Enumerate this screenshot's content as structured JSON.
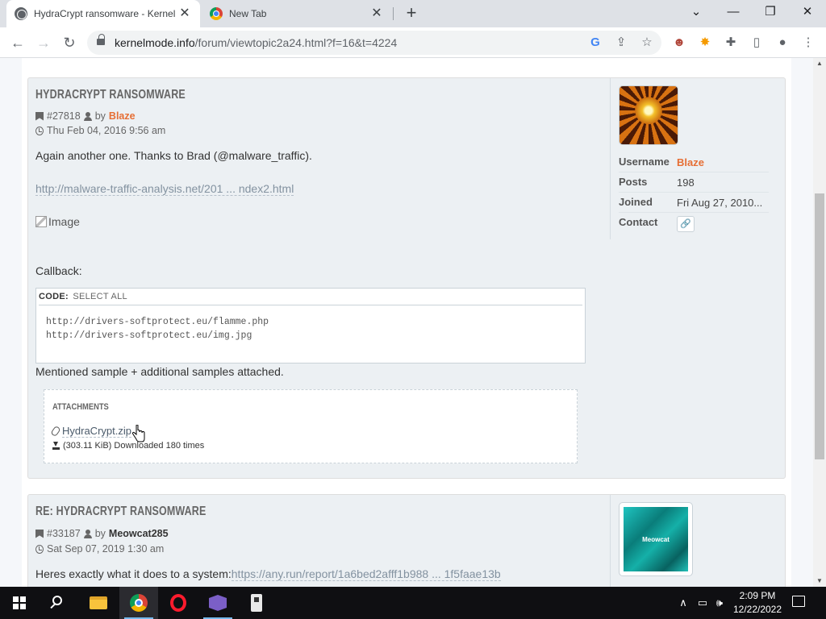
{
  "browser": {
    "tabs": [
      {
        "title": "HydraCrypt ransomware - Kernel",
        "active": true
      },
      {
        "title": "New Tab",
        "active": false
      }
    ],
    "close_glyph": "✕",
    "new_tab_glyph": "+",
    "url_host": "kernelmode.info",
    "url_path": "/forum/viewtopic2a24.html?f=16&t=4224",
    "window_controls": {
      "dropdown": "⌄",
      "minimize": "—",
      "restore": "❐",
      "close": "✕"
    },
    "nav": {
      "back": "←",
      "forward": "→",
      "reload": "↻"
    },
    "omnibox_icons": {
      "google": "G",
      "share": "⇪",
      "star": "☆"
    },
    "extensions": [
      "avatar-extension-icon",
      "sun-extension-icon",
      "puzzle-icon",
      "side-panel-icon",
      "profile-icon",
      "menu-icon"
    ],
    "ext_glyphs": [
      "☻",
      "✸",
      "✚",
      "▯",
      "●",
      "⋮"
    ]
  },
  "posts": [
    {
      "title": "HydraCrypt ransomware",
      "post_id": "#27818",
      "by": "by",
      "author": "Blaze",
      "date": "Thu Feb 04, 2016 9:56 am",
      "intro": "Again another one. Thanks to Brad (@malware_traffic).",
      "link": "http://malware-traffic-analysis.net/201 ... ndex2.html",
      "image_alt": "Image",
      "callback_label": "Callback:",
      "code": {
        "label": "CODE:",
        "select_all": "SELECT ALL",
        "lines": [
          "http://drivers-softprotect.eu/flamme.php",
          "http://drivers-softprotect.eu/img.jpg"
        ]
      },
      "mention": "Mentioned sample + additional samples attached.",
      "attachments": {
        "heading": "Attachments",
        "file": "HydraCrypt.zip",
        "info": "(303.11 KiB) Downloaded 180 times"
      },
      "profile": {
        "username_label": "Username",
        "username": "Blaze",
        "posts_label": "Posts",
        "posts": "198",
        "joined_label": "Joined",
        "joined": "Fri Aug 27, 2010...",
        "contact_label": "Contact",
        "contact_icon": "link-icon"
      }
    },
    {
      "title": "Re: HydraCrypt ransomware",
      "post_id": "#33187",
      "by": "by",
      "author": "Meowcat285",
      "date": "Sat Sep 07, 2019 1:30 am",
      "body_prefix": "Heres exactly what it does to a system:",
      "body_link": "https://any.run/report/1a6bed2afff1b988 ... 1f5faae13b",
      "avatar_text": "Meowcat"
    }
  ],
  "taskbar": {
    "time": "2:09 PM",
    "date": "12/22/2022",
    "tray_up": "∧",
    "tray_net": "▭",
    "tray_vol": "🕪"
  },
  "colors": {
    "accent_orange": "#e66e34",
    "post_bg": "#ecf0f3",
    "link_gray": "#8392a0"
  }
}
